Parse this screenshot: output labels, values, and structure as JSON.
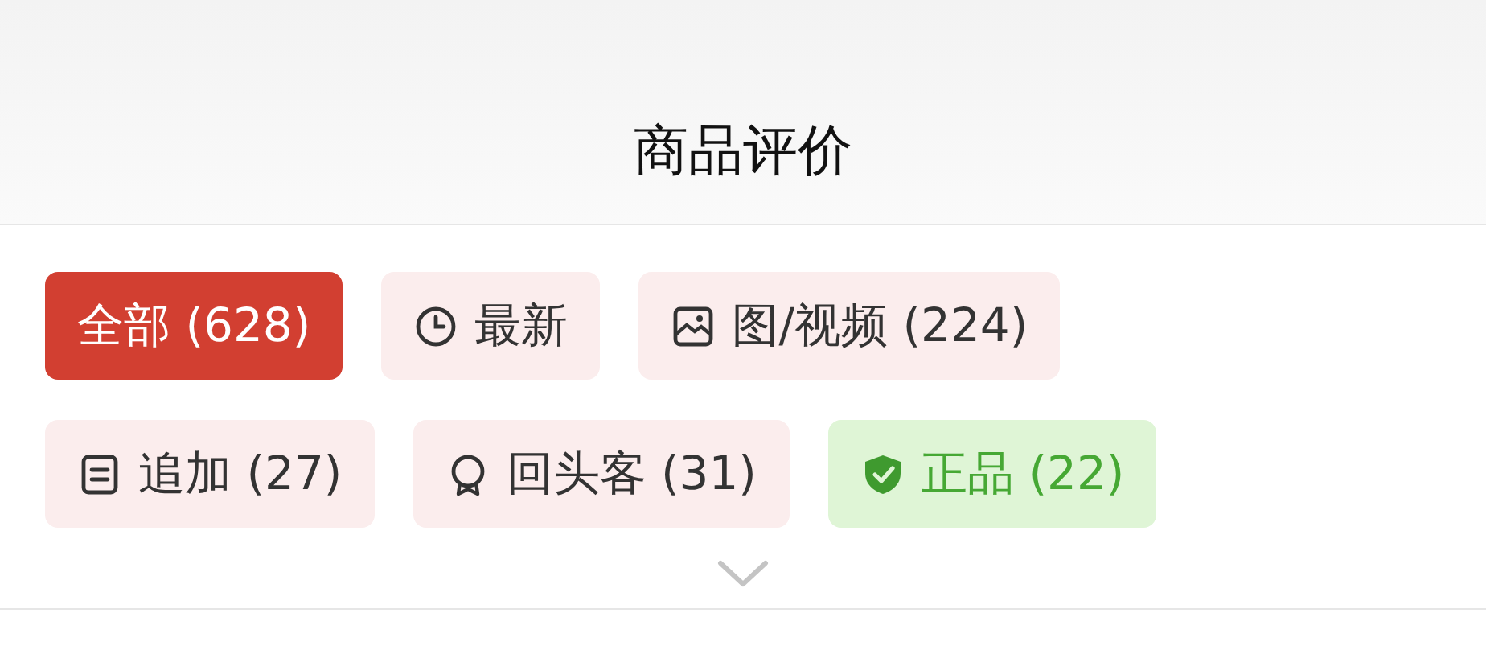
{
  "header": {
    "title": "商品评价"
  },
  "filters": [
    {
      "label": "全部 (628)",
      "kind": "all",
      "selected": true
    },
    {
      "label": "最新",
      "kind": "latest",
      "selected": false
    },
    {
      "label": "图/视频 (224)",
      "kind": "media",
      "selected": false
    },
    {
      "label": "追加 (27)",
      "kind": "followup",
      "selected": false
    },
    {
      "label": "回头客 (31)",
      "kind": "returning",
      "selected": false
    },
    {
      "label": "正品 (22)",
      "kind": "genuine",
      "selected": false
    }
  ],
  "expand": {
    "expanded": false
  }
}
